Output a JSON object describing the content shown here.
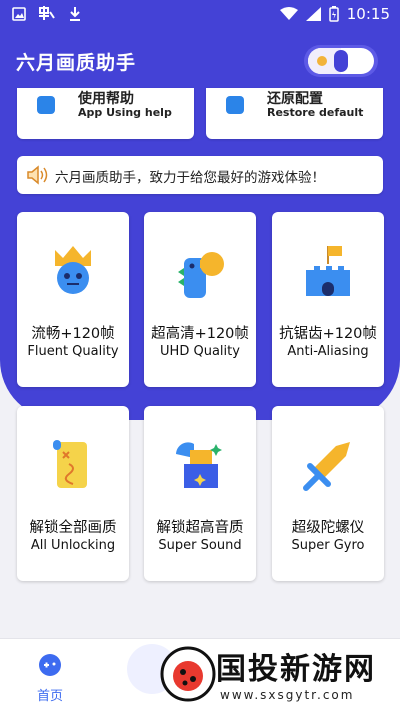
{
  "status": {
    "time": "10:15"
  },
  "app": {
    "title": "六月画质助手"
  },
  "help": [
    {
      "title": "使用帮助",
      "subtitle": "App Using help"
    },
    {
      "title": "还原配置",
      "subtitle": "Restore default"
    }
  ],
  "notice": {
    "text": "六月画质助手，致力于给您最好的游戏体验！"
  },
  "tiles": [
    {
      "zh": "流畅+120帧",
      "en": "Fluent Quality",
      "icon": "crown-face-icon"
    },
    {
      "zh": "超高清+120帧",
      "en": "UHD Quality",
      "icon": "dinosaur-icon"
    },
    {
      "zh": "抗锯齿+120帧",
      "en": "Anti-Aliasing",
      "icon": "castle-flag-icon"
    },
    {
      "zh": "解锁全部画质",
      "en": "All Unlocking",
      "icon": "scroll-map-icon"
    },
    {
      "zh": "解锁超高音质",
      "en": "Super Sound",
      "icon": "blocks-sparkle-icon"
    },
    {
      "zh": "超级陀螺仪",
      "en": "Super Gyro",
      "icon": "sword-icon"
    }
  ],
  "nav": {
    "home_label": "首页"
  },
  "watermark": {
    "text": "国投新游网",
    "url": "www.sxsgytr.com"
  },
  "colors": {
    "primary": "#4442d6",
    "accent": "#3d6bf0",
    "card": "#ffffff"
  }
}
